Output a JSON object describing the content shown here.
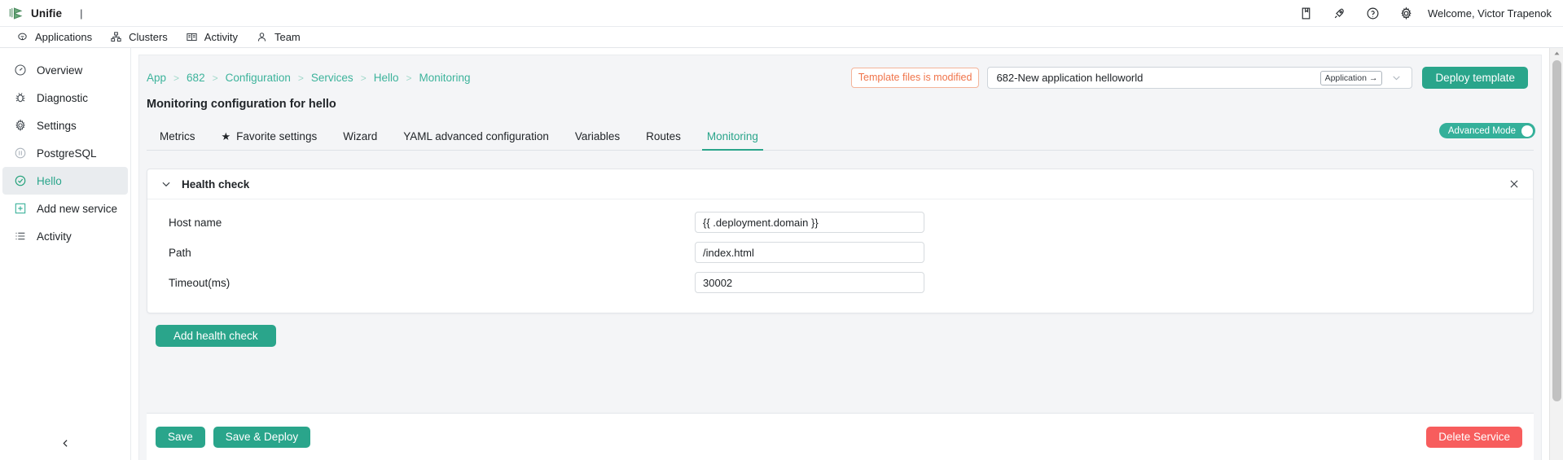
{
  "topbar": {
    "brand_name": "Unifie",
    "separator": "|",
    "icons": [
      {
        "name": "docs-icon",
        "glyph": "docs"
      },
      {
        "name": "rocket-icon",
        "glyph": "rocket"
      },
      {
        "name": "help-icon",
        "glyph": "help"
      },
      {
        "name": "settings-gear-icon",
        "glyph": "gear"
      }
    ],
    "welcome": "Welcome, Victor Trapenok"
  },
  "navbar": {
    "items": [
      {
        "label": "Applications",
        "icon": "applications-icon"
      },
      {
        "label": "Clusters",
        "icon": "clusters-icon"
      },
      {
        "label": "Activity",
        "icon": "activity-book-icon"
      },
      {
        "label": "Team",
        "icon": "team-person-icon"
      }
    ]
  },
  "sidebar": {
    "items": [
      {
        "label": "Overview",
        "icon": "gauge-icon",
        "active": false
      },
      {
        "label": "Diagnostic",
        "icon": "bug-icon",
        "active": false
      },
      {
        "label": "Settings",
        "icon": "gear-icon",
        "active": false
      },
      {
        "label": "PostgreSQL",
        "icon": "database-icon",
        "active": false
      },
      {
        "label": "Hello",
        "icon": "check-circle-icon",
        "active": true
      },
      {
        "label": "Add new service",
        "icon": "plus-square-icon",
        "active": false
      },
      {
        "label": "Activity",
        "icon": "list-icon",
        "active": false
      }
    ],
    "collapse_icon": "chevron-left-icon"
  },
  "header": {
    "breadcrumb": [
      "App",
      "682",
      "Configuration",
      "Services",
      "Hello",
      "Monitoring"
    ],
    "breadcrumb_separator": ">",
    "modified_badge": "Template files is modified",
    "template_value": "682-New application helloworld",
    "template_chip": "Application",
    "template_chip_arrow": "→",
    "deploy_button": "Deploy template",
    "page_title": "Monitoring configuration for hello"
  },
  "tabs": {
    "items": [
      {
        "label": "Metrics",
        "active": false,
        "star": false
      },
      {
        "label": "Favorite settings",
        "active": false,
        "star": true
      },
      {
        "label": "Wizard",
        "active": false,
        "star": false
      },
      {
        "label": "YAML advanced configuration",
        "active": false,
        "star": false
      },
      {
        "label": "Variables",
        "active": false,
        "star": false
      },
      {
        "label": "Routes",
        "active": false,
        "star": false
      },
      {
        "label": "Monitoring",
        "active": true,
        "star": false
      }
    ],
    "advanced_mode_label": "Advanced Mode",
    "advanced_mode_on": true
  },
  "panel": {
    "title": "Health check",
    "collapse_icon": "chevron-down-icon",
    "close_icon": "close-icon",
    "fields": [
      {
        "label": "Host name",
        "value": "{{ .deployment.domain }}",
        "placeholder": ""
      },
      {
        "label": "Path",
        "value": "/index.html",
        "placeholder": ""
      },
      {
        "label": "Timeout(ms)",
        "value": "30002",
        "placeholder": ""
      }
    ],
    "add_button": "Add health check"
  },
  "footer": {
    "save": "Save",
    "save_deploy": "Save & Deploy",
    "delete": "Delete Service"
  },
  "colors": {
    "accent_teal": "#2aa58b",
    "danger_red": "#f75d5d",
    "warning_orange": "#f0744a",
    "brand_green": "#4a8a5e"
  }
}
